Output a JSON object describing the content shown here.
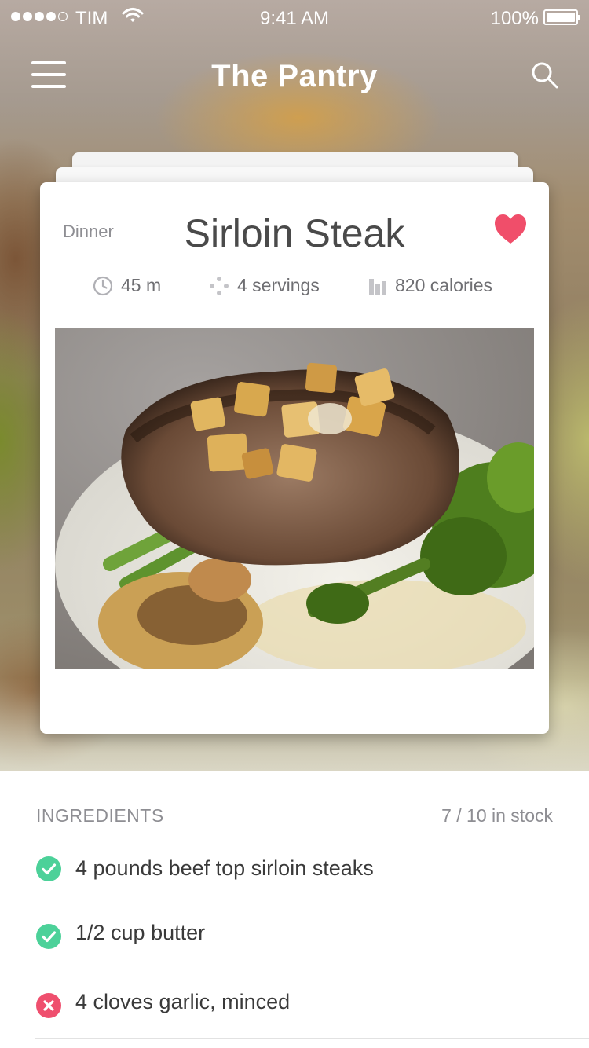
{
  "status_bar": {
    "carrier": "TIM",
    "time": "9:41 AM",
    "battery": "100%",
    "signal_bars_filled": 4,
    "signal_bars_total": 5
  },
  "nav": {
    "title": "The Pantry",
    "menu_icon": "hamburger-menu-icon",
    "search_icon": "search-icon"
  },
  "recipe": {
    "category": "Dinner",
    "title": "Sirloin Steak",
    "favorite": true,
    "favorite_color": "#f04e6a",
    "time": "45 m",
    "servings": "4 servings",
    "calories": "820 calories"
  },
  "ingredients": {
    "heading": "INGREDIENTS",
    "stock_summary": "7 / 10 in stock",
    "items": [
      {
        "text": "4 pounds beef top sirloin steaks",
        "in_stock": true
      },
      {
        "text": "1/2 cup butter",
        "in_stock": true
      },
      {
        "text": "4 cloves garlic, minced",
        "in_stock": false
      }
    ]
  },
  "colors": {
    "in_stock": "#4cd199",
    "out_of_stock": "#ef4f6e",
    "text_primary": "#4a4a4a",
    "text_secondary": "#8e8e93"
  }
}
